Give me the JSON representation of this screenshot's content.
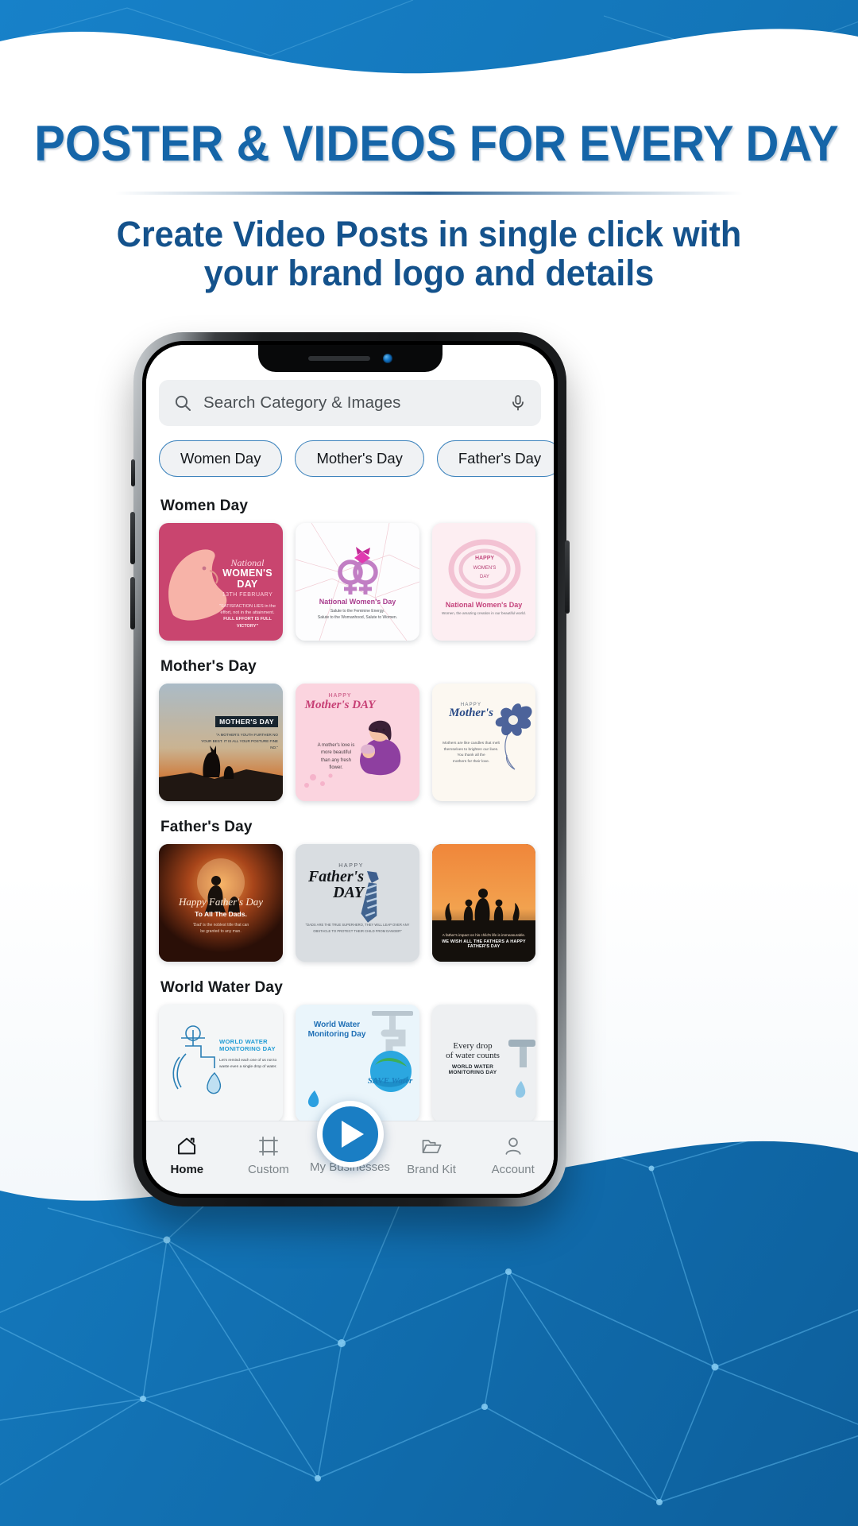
{
  "promo": {
    "headline": "POSTER & VIDEOS FOR EVERY DAY",
    "subhead_line1": "Create Video Posts in single click with",
    "subhead_line2": "your brand logo and details",
    "accent_blue": "#1565a8",
    "bg_blue": "#1477bd"
  },
  "app": {
    "search": {
      "placeholder": "Search Category & Images",
      "value": "",
      "search_icon": "search-icon",
      "mic_icon": "microphone-icon"
    },
    "chips": [
      {
        "label": "Women Day"
      },
      {
        "label": "Mother's Day"
      },
      {
        "label": "Father's Day"
      }
    ],
    "sections": [
      {
        "title": "Women Day",
        "cards": [
          {
            "bg": "#c9456f",
            "title_script": "National",
            "title_bold": "WOMEN'S DAY",
            "date": "13TH FEBRUARY",
            "quote_l1": "\"SATISFACTION LIES in the",
            "quote_l2": "effort, not in the attainment.",
            "quote_l3": "FULL EFFORT IS FULL VICTORY\""
          },
          {
            "bg": "#fbfbfc",
            "title_bold": "National Women's Day",
            "quote_l1": "Salute to the Feminine Energy.",
            "quote_l2": "Salute to the Womanhood, Salute to Women."
          },
          {
            "bg": "#fcebee",
            "title_bold": "National Women's Day",
            "quote_l1": "Women, the amazing creation in our beautiful world."
          }
        ]
      },
      {
        "title": "Mother's Day",
        "cards": [
          {
            "bg": "#8ba6bd",
            "title_bold": "MOTHER'S DAY",
            "quote_l1": "\"A MOTHER'S YOUTH FURTHER NO",
            "quote_l2": "YOUR BEST. IT IS ALL YOUR POSTURE FINE NO.\""
          },
          {
            "bg": "#fbd4df",
            "title_script": "HAPPY",
            "title_bold": "Mother's DAY",
            "quote_l1": "A mother's love is",
            "quote_l2": "more beautiful",
            "quote_l3": "than any fresh",
            "quote_l4": "flower."
          },
          {
            "bg": "#fbf7f0",
            "title_script": "HAPPY",
            "title_bold": "Mother's",
            "quote_l1": "Mothers are like candles that melt",
            "quote_l2": "themselves to brighten our lives.",
            "quote_l3": "You thank all the",
            "quote_l4": "mothers for their love."
          }
        ]
      },
      {
        "title": "Father's Day",
        "cards": [
          {
            "bg": "#331208",
            "title_script": "Happy Father's Day",
            "title_bold": "To All The Dads.",
            "quote_l1": "'Dad' is the noblest title that can",
            "quote_l2": "be granted to any man."
          },
          {
            "bg": "#d9dde1",
            "title_script": "HAPPY",
            "title_bold": "Father's DAY",
            "quote_l1": "\"DADS ARE THE TRUE SUPERHERO, THEY WILL LEAP OVER ANY",
            "quote_l2": "OBSTACLE TO PROTECT THEIR CHILD FROM DANGER\""
          },
          {
            "bg": "#e8762f",
            "quote_l1": "A father's impact on his child's life is immeasurable.",
            "title_bold": "WE WISH ALL THE FATHERS A HAPPY FATHER'S DAY"
          }
        ]
      },
      {
        "title": "World Water Day",
        "cards": [
          {
            "bg": "#f3f5f6",
            "title_bold": "WORLD WATER MONITORING DAY",
            "quote_l1": "Let's remind each one of us not to",
            "quote_l2": "waste even a single drop of water."
          },
          {
            "bg": "#e9f5fb",
            "title_bold": "World Water Monitoring Day",
            "title_script": "SAVE Water"
          },
          {
            "bg": "#eceef0",
            "title_script": "Every drop",
            "title_bold": "of water counts",
            "quote_l1": "WORLD WATER MONITORING DAY"
          }
        ]
      }
    ],
    "nav": [
      {
        "label": "Home",
        "icon": "home-icon",
        "active": true
      },
      {
        "label": "Custom",
        "icon": "crop-icon",
        "active": false
      },
      {
        "label": "My Businesses",
        "icon": "play-icon",
        "active": false
      },
      {
        "label": "Brand Kit",
        "icon": "folder-icon",
        "active": false
      },
      {
        "label": "Account",
        "icon": "person-icon",
        "active": false
      }
    ]
  }
}
